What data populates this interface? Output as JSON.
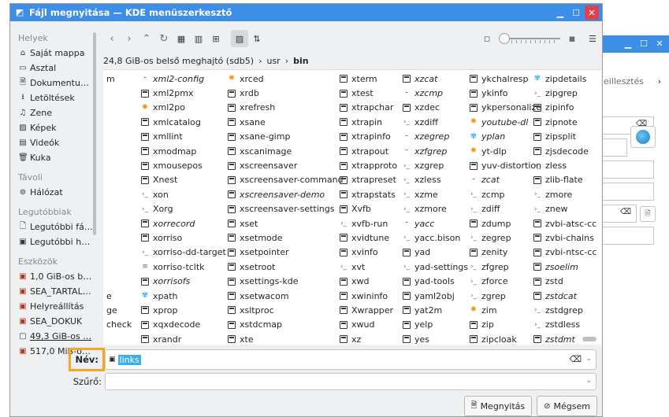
{
  "window": {
    "title": "Fájl megnyitása — KDE menüszerkesztő"
  },
  "background_window": {
    "tab_label": "eillesztés"
  },
  "sidebar": {
    "groups": [
      {
        "label": "Helyek",
        "items": [
          {
            "label": "Saját mappa",
            "icon": "home-icon"
          },
          {
            "label": "Asztal",
            "icon": "desktop-icon"
          },
          {
            "label": "Dokumentu…",
            "icon": "documents-icon"
          },
          {
            "label": "Letöltések",
            "icon": "downloads-icon"
          },
          {
            "label": "Zene",
            "icon": "music-icon"
          },
          {
            "label": "Képek",
            "icon": "pictures-icon"
          },
          {
            "label": "Videók",
            "icon": "videos-icon"
          },
          {
            "label": "Kuka",
            "icon": "trash-icon"
          }
        ]
      },
      {
        "label": "Távoli",
        "items": [
          {
            "label": "Hálózat",
            "icon": "network-icon"
          }
        ]
      },
      {
        "label": "Legutóbbiak",
        "items": [
          {
            "label": "Legutóbbi fá…",
            "icon": "recent-files-icon"
          },
          {
            "label": "Legutóbbi h…",
            "icon": "recent-locations-icon"
          }
        ]
      },
      {
        "label": "Eszközök",
        "items": [
          {
            "label": "1,0 GiB-os b…",
            "icon": "drive-icon"
          },
          {
            "label": "SEA_TARTAL…",
            "icon": "drive-icon"
          },
          {
            "label": "Helyreállítás",
            "icon": "drive-icon"
          },
          {
            "label": "SEA_DOKUK",
            "icon": "drive-icon"
          },
          {
            "label": "49,3 GiB-os …",
            "icon": "drive-icon",
            "selected": true
          },
          {
            "label": "517,0 MiB-o…",
            "icon": "drive-icon"
          }
        ]
      }
    ]
  },
  "breadcrumb": {
    "drive": "24,8 GiB-os belső meghajtó (sdb5)",
    "parts": [
      "usr"
    ],
    "current": "bin"
  },
  "files": {
    "col0": [
      {
        "name": "m",
        "icon": "none"
      },
      {
        "name": "",
        "icon": "none"
      },
      {
        "name": "",
        "icon": "none"
      },
      {
        "name": "",
        "icon": "none"
      },
      {
        "name": "",
        "icon": "none"
      },
      {
        "name": "",
        "icon": "none"
      },
      {
        "name": "",
        "icon": "none"
      },
      {
        "name": "",
        "icon": "none"
      },
      {
        "name": "",
        "icon": "none"
      },
      {
        "name": "",
        "icon": "none"
      },
      {
        "name": "",
        "icon": "none"
      },
      {
        "name": "",
        "icon": "none"
      },
      {
        "name": "",
        "icon": "none"
      },
      {
        "name": "",
        "icon": "none"
      },
      {
        "name": "",
        "icon": "none"
      },
      {
        "name": "e",
        "icon": "none"
      },
      {
        "name": "ge",
        "icon": "none"
      },
      {
        "name": "check",
        "icon": "none"
      }
    ],
    "col1": [
      {
        "name": "xml2-config",
        "icon": "sh",
        "italic": true
      },
      {
        "name": "xml2pmx",
        "icon": "exe"
      },
      {
        "name": "xml2po",
        "icon": "gear"
      },
      {
        "name": "xmlcatalog",
        "icon": "exe"
      },
      {
        "name": "xmllint",
        "icon": "exe"
      },
      {
        "name": "xmodmap",
        "icon": "exe"
      },
      {
        "name": "xmousepos",
        "icon": "exe"
      },
      {
        "name": "Xnest",
        "icon": "exe"
      },
      {
        "name": "xon",
        "icon": "link"
      },
      {
        "name": "Xorg",
        "icon": "link"
      },
      {
        "name": "xorrecord",
        "icon": "exe",
        "italic": true
      },
      {
        "name": "xorriso",
        "icon": "exe"
      },
      {
        "name": "xorriso-dd-target",
        "icon": "link"
      },
      {
        "name": "xorriso-tcltk",
        "icon": "txt"
      },
      {
        "name": "xorrisofs",
        "icon": "exe",
        "italic": true
      },
      {
        "name": "xpath",
        "icon": "py"
      },
      {
        "name": "xprop",
        "icon": "exe"
      },
      {
        "name": "xqxdecode",
        "icon": "exe"
      },
      {
        "name": "xrandr",
        "icon": "exe"
      }
    ],
    "col2": [
      {
        "name": "xrced",
        "icon": "gear"
      },
      {
        "name": "xrdb",
        "icon": "exe"
      },
      {
        "name": "xrefresh",
        "icon": "exe"
      },
      {
        "name": "xsane",
        "icon": "exe"
      },
      {
        "name": "xsane-gimp",
        "icon": "exe"
      },
      {
        "name": "xscanimage",
        "icon": "exe"
      },
      {
        "name": "xscreensaver",
        "icon": "exe"
      },
      {
        "name": "xscreensaver-command",
        "icon": "exe"
      },
      {
        "name": "xscreensaver-demo",
        "icon": "exe",
        "italic": true
      },
      {
        "name": "xscreensaver-settings",
        "icon": "exe"
      },
      {
        "name": "xset",
        "icon": "exe"
      },
      {
        "name": "xsetmode",
        "icon": "exe"
      },
      {
        "name": "xsetpointer",
        "icon": "exe"
      },
      {
        "name": "xsetroot",
        "icon": "exe"
      },
      {
        "name": "xsettings-kde",
        "icon": "exe"
      },
      {
        "name": "xsetwacom",
        "icon": "exe"
      },
      {
        "name": "xsltproc",
        "icon": "exe"
      },
      {
        "name": "xstdcmap",
        "icon": "exe"
      },
      {
        "name": "xte",
        "icon": "exe"
      }
    ],
    "col3": [
      {
        "name": "xterm",
        "icon": "exe"
      },
      {
        "name": "xtest",
        "icon": "exe"
      },
      {
        "name": "xtrapchar",
        "icon": "exe"
      },
      {
        "name": "xtrapin",
        "icon": "exe"
      },
      {
        "name": "xtrapinfo",
        "icon": "exe"
      },
      {
        "name": "xtrapout",
        "icon": "exe"
      },
      {
        "name": "xtrapproto",
        "icon": "exe"
      },
      {
        "name": "xtrapreset",
        "icon": "exe"
      },
      {
        "name": "xtrapstats",
        "icon": "exe"
      },
      {
        "name": "Xvfb",
        "icon": "exe"
      },
      {
        "name": "xvfb-run",
        "icon": "link"
      },
      {
        "name": "xvidtune",
        "icon": "exe"
      },
      {
        "name": "xvinfo",
        "icon": "exe"
      },
      {
        "name": "xvt",
        "icon": "link"
      },
      {
        "name": "xwd",
        "icon": "exe"
      },
      {
        "name": "xwininfo",
        "icon": "exe"
      },
      {
        "name": "Xwrapper",
        "icon": "exe"
      },
      {
        "name": "xwud",
        "icon": "exe"
      },
      {
        "name": "xz",
        "icon": "exe"
      }
    ],
    "col4": [
      {
        "name": "xzcat",
        "icon": "exe",
        "italic": true
      },
      {
        "name": "xzcmp",
        "icon": "sh",
        "italic": true
      },
      {
        "name": "xzdec",
        "icon": "exe"
      },
      {
        "name": "xzdiff",
        "icon": "link"
      },
      {
        "name": "xzegrep",
        "icon": "sh",
        "italic": true
      },
      {
        "name": "xzfgrep",
        "icon": "sh",
        "italic": true
      },
      {
        "name": "xzgrep",
        "icon": "link"
      },
      {
        "name": "xzless",
        "icon": "link"
      },
      {
        "name": "xzme",
        "icon": "link"
      },
      {
        "name": "xzmore",
        "icon": "link"
      },
      {
        "name": "yacc",
        "icon": "sh",
        "italic": true
      },
      {
        "name": "yacc.bison",
        "icon": "link"
      },
      {
        "name": "yad",
        "icon": "exe"
      },
      {
        "name": "yad-settings",
        "icon": "link"
      },
      {
        "name": "yad-tools",
        "icon": "exe"
      },
      {
        "name": "yaml2obj",
        "icon": "exe"
      },
      {
        "name": "yat2m",
        "icon": "exe"
      },
      {
        "name": "yelp",
        "icon": "exe"
      },
      {
        "name": "yes",
        "icon": "exe"
      }
    ],
    "col5": [
      {
        "name": "ykchalresp",
        "icon": "exe"
      },
      {
        "name": "ykinfo",
        "icon": "exe"
      },
      {
        "name": "ykpersonalize",
        "icon": "exe"
      },
      {
        "name": "youtube-dl",
        "icon": "gear",
        "italic": true
      },
      {
        "name": "yplan",
        "icon": "py",
        "italic": true
      },
      {
        "name": "yt-dlp",
        "icon": "gear"
      },
      {
        "name": "yuv-distortion",
        "icon": "exe"
      },
      {
        "name": "zcat",
        "icon": "sh",
        "italic": true
      },
      {
        "name": "zcmp",
        "icon": "link"
      },
      {
        "name": "zdiff",
        "icon": "link"
      },
      {
        "name": "zdump",
        "icon": "exe"
      },
      {
        "name": "zegrep",
        "icon": "link"
      },
      {
        "name": "zenity",
        "icon": "exe"
      },
      {
        "name": "zfgrep",
        "icon": "link"
      },
      {
        "name": "zforce",
        "icon": "link"
      },
      {
        "name": "zgrep",
        "icon": "link"
      },
      {
        "name": "zim",
        "icon": "gear"
      },
      {
        "name": "zip",
        "icon": "exe"
      },
      {
        "name": "zipcloak",
        "icon": "exe"
      }
    ],
    "col6": [
      {
        "name": "zipdetails",
        "icon": "py"
      },
      {
        "name": "zipgrep",
        "icon": "link"
      },
      {
        "name": "zipinfo",
        "icon": "exe"
      },
      {
        "name": "zipnote",
        "icon": "exe"
      },
      {
        "name": "zipsplit",
        "icon": "exe"
      },
      {
        "name": "zjsdecode",
        "icon": "exe"
      },
      {
        "name": "zless",
        "icon": "link"
      },
      {
        "name": "zlib-flate",
        "icon": "exe"
      },
      {
        "name": "zmore",
        "icon": "link"
      },
      {
        "name": "znew",
        "icon": "link"
      },
      {
        "name": "zvbi-atsc-cc",
        "icon": "exe"
      },
      {
        "name": "zvbi-chains",
        "icon": "exe"
      },
      {
        "name": "zvbi-ntsc-cc",
        "icon": "exe"
      },
      {
        "name": "zsoelim",
        "icon": "exe",
        "italic": true
      },
      {
        "name": "zstd",
        "icon": "exe"
      },
      {
        "name": "zstdcat",
        "icon": "exe",
        "italic": true
      },
      {
        "name": "zstdgrep",
        "icon": "link"
      },
      {
        "name": "zstdless",
        "icon": "link"
      },
      {
        "name": "zstdmt",
        "icon": "exe",
        "italic": true
      }
    ]
  },
  "name_field": {
    "label": "Név:",
    "value": "links"
  },
  "filter_field": {
    "label": "Szűrő:",
    "value": ""
  },
  "buttons": {
    "open": "Megnyitás",
    "cancel": "Mégsem"
  },
  "colors": {
    "titlebar": "#3d8ee6",
    "selection": "#3daee9",
    "highlight_border": "#f5a623",
    "close_button": "#da4453"
  }
}
